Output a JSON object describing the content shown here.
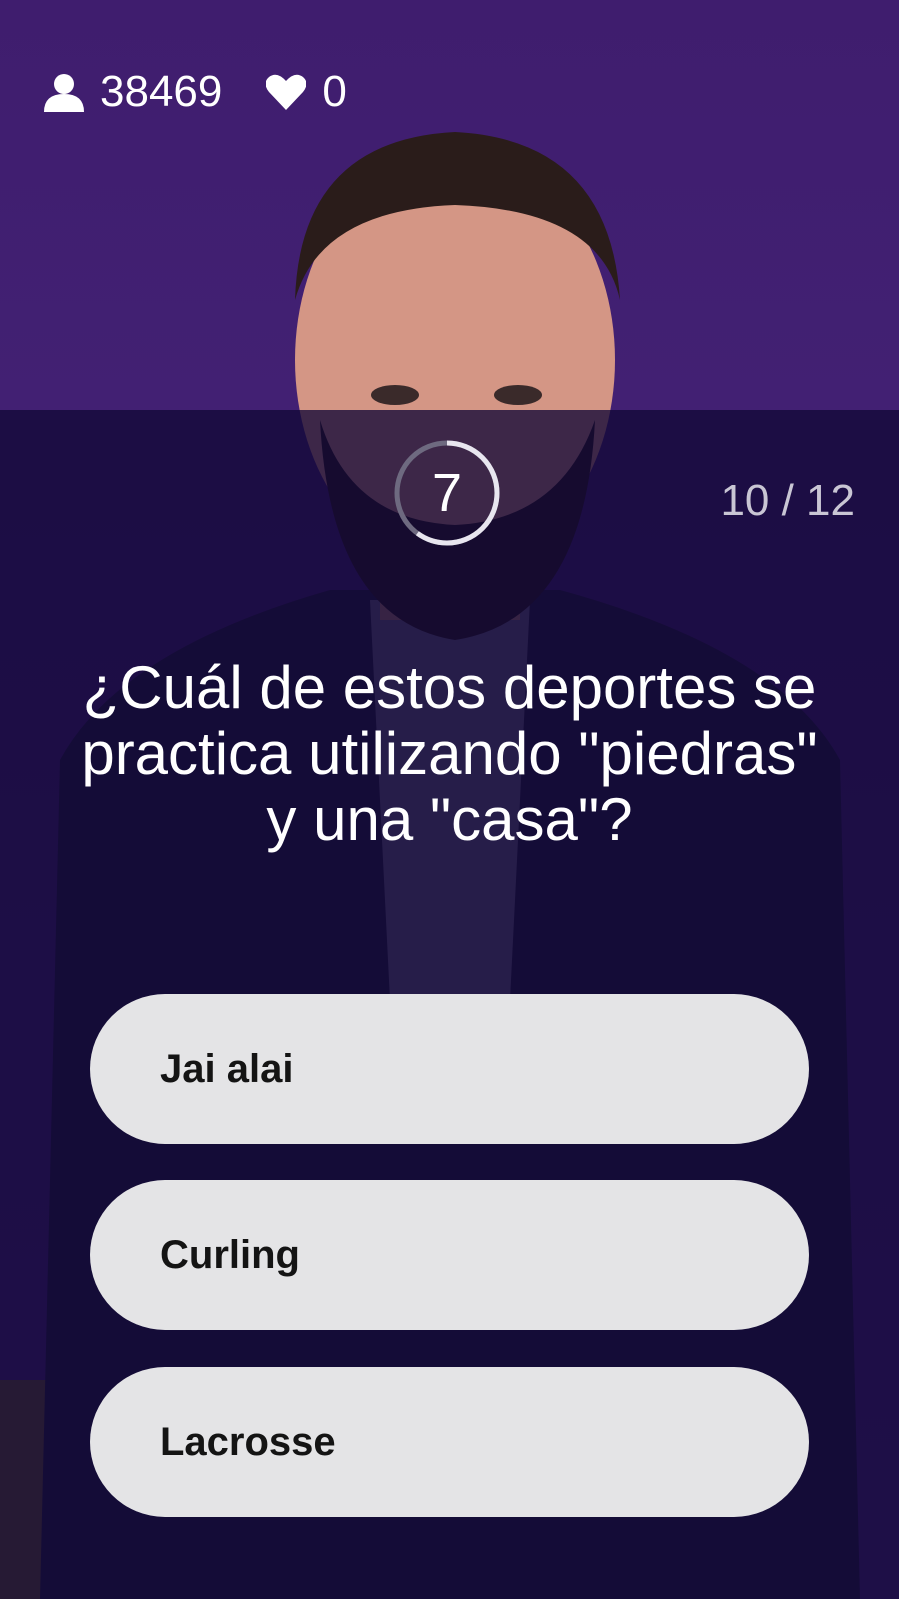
{
  "stats": {
    "viewers_icon": "person-icon",
    "viewers": "38469",
    "lives_icon": "heart-icon",
    "lives": "0"
  },
  "timer": {
    "seconds_left": "7",
    "ring_fraction_remaining": 0.6
  },
  "progress": "10 / 12",
  "question": "¿Cuál de estos deportes se practica utilizando \"piedras\" y una \"casa\"?",
  "answers": [
    {
      "label": "Jai alai"
    },
    {
      "label": "Curling"
    },
    {
      "label": "Lacrosse"
    }
  ],
  "colors": {
    "background_purple": "#3a1f6b",
    "overlay": "#120837",
    "answer_bg": "#e4e4e6",
    "answer_text": "#141414"
  }
}
